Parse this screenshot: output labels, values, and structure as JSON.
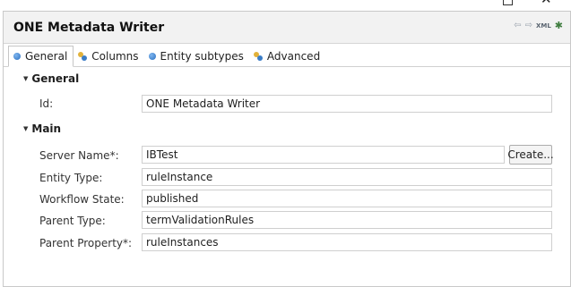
{
  "window": {
    "maximize_glyph": "",
    "close_glyph": "✕"
  },
  "editor": {
    "title": "ONE Metadata Writer",
    "tools": {
      "back_glyph": "⇦",
      "forward_glyph": "⇨",
      "xml_label": "XML",
      "settings_glyph": "✱"
    }
  },
  "tabs": [
    {
      "label": "General",
      "icon": "blue-dot-icon",
      "active": true
    },
    {
      "label": "Columns",
      "icon": "cluster-icon",
      "active": false
    },
    {
      "label": "Entity subtypes",
      "icon": "blue-dot-icon",
      "active": false
    },
    {
      "label": "Advanced",
      "icon": "cluster-icon",
      "active": false
    }
  ],
  "sections": {
    "general": {
      "title": "General",
      "fields": {
        "id": {
          "label": "Id:",
          "value": "ONE Metadata Writer"
        }
      }
    },
    "main": {
      "title": "Main",
      "fields": {
        "server_name": {
          "label": "Server Name*:",
          "value": "IBTest",
          "button": "Create..."
        },
        "entity_type": {
          "label": "Entity Type:",
          "value": "ruleInstance"
        },
        "workflow_state": {
          "label": "Workflow State:",
          "value": "published"
        },
        "parent_type": {
          "label": "Parent Type:",
          "value": "termValidationRules"
        },
        "parent_property": {
          "label": "Parent Property*:",
          "value": "ruleInstances"
        }
      }
    }
  }
}
